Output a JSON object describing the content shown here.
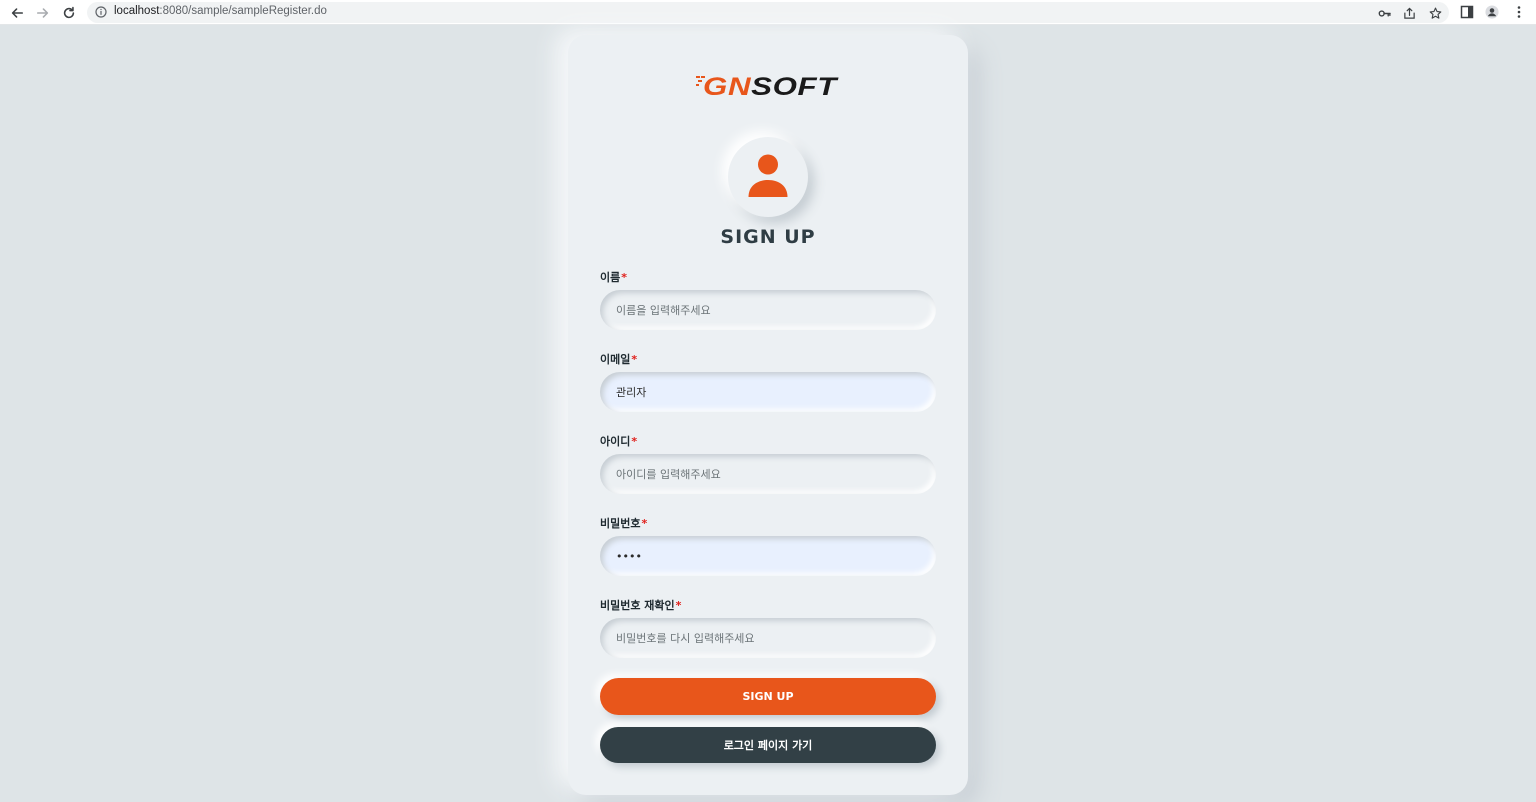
{
  "browser": {
    "url_host": "localhost",
    "url_path": ":8080/sample/sampleRegister.do"
  },
  "brand": {
    "logo_text": "GNSOFT",
    "accent_color": "#e8561b",
    "dark_color": "#324046"
  },
  "form": {
    "title": "SIGN UP",
    "required_mark": "*",
    "fields": [
      {
        "label": "이름",
        "value": "",
        "placeholder": "이름을 입력해주세요"
      },
      {
        "label": "이메일",
        "value": "관리자",
        "placeholder": ""
      },
      {
        "label": "아이디",
        "value": "",
        "placeholder": "아이디를 입력해주세요"
      },
      {
        "label": "비밀번호",
        "value": "••••",
        "placeholder": ""
      },
      {
        "label": "비밀번호 재확인",
        "value": "",
        "placeholder": "비밀번호를 다시 입력해주세요"
      }
    ],
    "submit_label": "SIGN UP",
    "login_link_label": "로그인 페이지 가기"
  }
}
